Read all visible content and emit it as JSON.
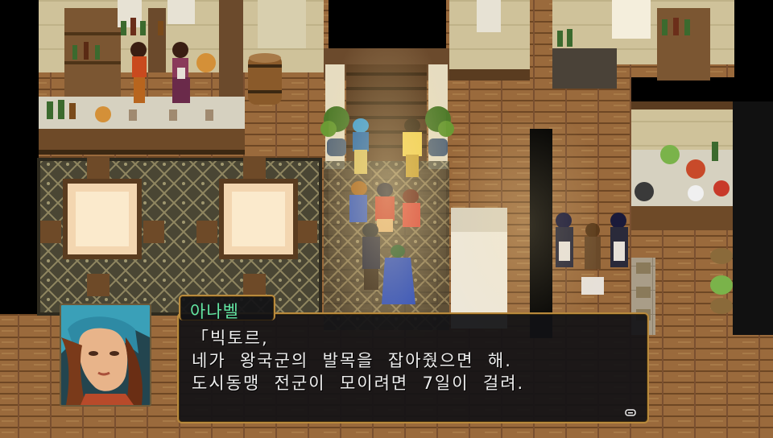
{
  "dialogue": {
    "speaker": "아나벨",
    "lines": [
      "「빅토르,",
      "네가  왕국군의  발목을  잡아줬으면  해.",
      "도시동맹  전군이  모이려면  7일이  걸려."
    ]
  },
  "icons": {
    "portrait": "character-portrait",
    "continue": "continue-arrow-icon"
  },
  "colors": {
    "dialogue_background": "#121216",
    "dialogue_border": "#b98a3c",
    "speaker_name": "#62e6a2",
    "dialogue_text": "#eeeeee"
  }
}
